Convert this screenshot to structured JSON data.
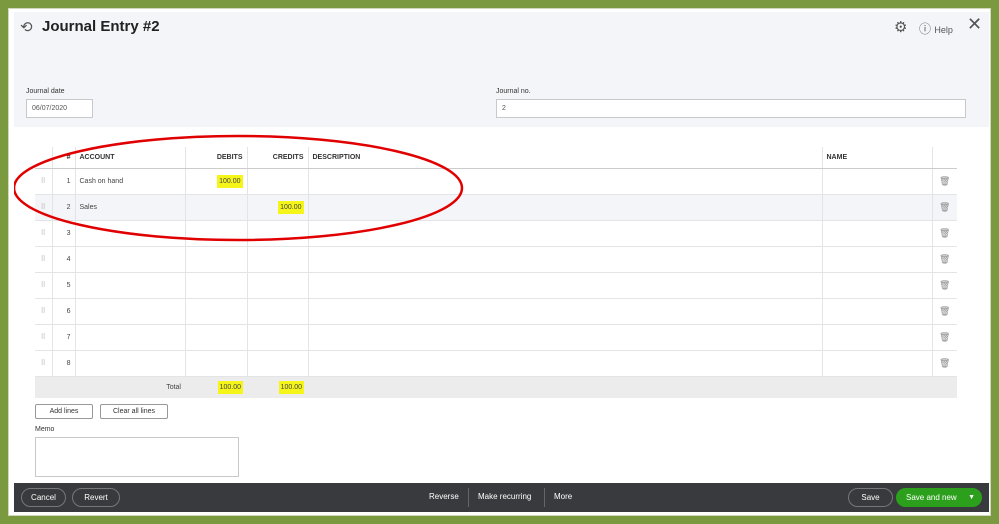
{
  "header": {
    "title": "Journal Entry #2",
    "help": "Help"
  },
  "form": {
    "date_label": "Journal date",
    "date_value": "06/07/2020",
    "no_label": "Journal no.",
    "no_value": "2"
  },
  "table": {
    "columns": [
      "#",
      "ACCOUNT",
      "DEBITS",
      "CREDITS",
      "DESCRIPTION",
      "NAME"
    ],
    "rows": [
      {
        "n": "1",
        "account": "Cash on hand",
        "debit": "100.00",
        "credit": ""
      },
      {
        "n": "2",
        "account": "Sales",
        "debit": "",
        "credit": "100.00"
      },
      {
        "n": "3"
      },
      {
        "n": "4"
      },
      {
        "n": "5"
      },
      {
        "n": "6"
      },
      {
        "n": "7"
      },
      {
        "n": "8"
      }
    ],
    "total_label": "Total",
    "total_debit": "100.00",
    "total_credit": "100.00"
  },
  "buttons": {
    "add_lines": "Add lines",
    "clear_lines": "Clear all lines"
  },
  "memo": {
    "label": "Memo",
    "value": ""
  },
  "footer": {
    "cancel": "Cancel",
    "revert": "Revert",
    "reverse": "Reverse",
    "make_recurring": "Make recurring",
    "more": "More",
    "save": "Save",
    "save_and_new": "Save and new"
  },
  "colors": {
    "highlight": "#f5f51a",
    "annotation": "#e00000",
    "save_green": "#2ca01c"
  }
}
